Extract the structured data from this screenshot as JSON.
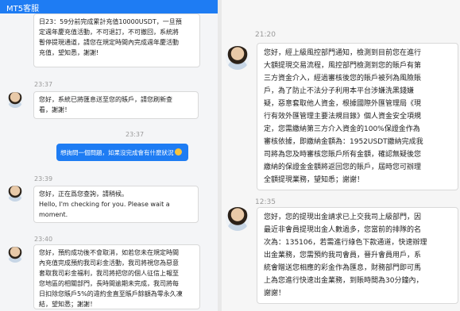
{
  "left": {
    "header_title": "MT5客服",
    "messages": [
      {
        "time": "",
        "text": "日23：59分前完成累計充值10000USDT，一旦預\n定週年慶充值活動，不可退訂，不可撤回，系統將\n暫停提現通道，請您在規定時間內完成週年慶活動\n充值，望知悉，謝謝!"
      },
      {
        "time": "23:37",
        "text": "您好，系統已將匯息送至您的賬戶，請您刷新查\n看，謝謝！"
      },
      {
        "time": "23:37",
        "text": "想詢問一個問題，如果沒完成會有什麼狀況",
        "emoji": "grinning-sweat-emoji"
      },
      {
        "time": "23:39",
        "text": "您好，正在爲您查詢，請稍候。\nHello, I'm checking for you. Please wait a\nmoment."
      },
      {
        "time": "23:40",
        "text": "您好，預約成功後不會取消，如若您未在規定時間\n內充值完成預約我司彩金活動，我司將視您為惡意\n套取我司彩金福利，我司將把您的個人征信上報至\n您地區的相關部門，長時間逾期未完成，我司將每\n日扣除您賬戶5%的違約金直至賬戶餘額為零永久凍\n結，望知悉；謝謝！"
      }
    ]
  },
  "right": {
    "messages": [
      {
        "time": "21:20",
        "text": "您好，經上級風控部門通知，檢測到目前您在進行\n大額提現交易流程，風控部門檢測到您的賬戶有第\n三方資金介入，經過審核後您的賬戶被列為風險賬\n戶，為了防止不法分子利用本平台涉嫌洗黑錢嫌\n疑，惡意套取他人資金，根據國際外匯管理局《現\n行有效外匯管理主要法規目錄》個人資金安全項規\n定，您需繳納第三方介入資金的100%保證金作為\n審核依據，即繳納金額為：1952USDT繳納完成我\n司將為您及時審核您賬戶所有金額，確認無疑後您\n繳納的保證金金額將返回您的賬戶，屆時您可辦理\n全額提現業務，望知悉；謝謝！"
      },
      {
        "time": "12:35",
        "text": "您好，您的提現出金請求已上交我司上級部門，因\n最近非會員提現出金人數過多，您當前的排隊的名\n次為：135106，若需進行綠色下款通道，快速辦理\n出金業務，您需預約我司會員，晉升會員用戶，系\n統會贈送您相應的彩金作為匯息，財務部門即可馬\n上為您進行快速出金業務，到賬時間為30分鐘內，\n謝謝！"
      }
    ]
  }
}
